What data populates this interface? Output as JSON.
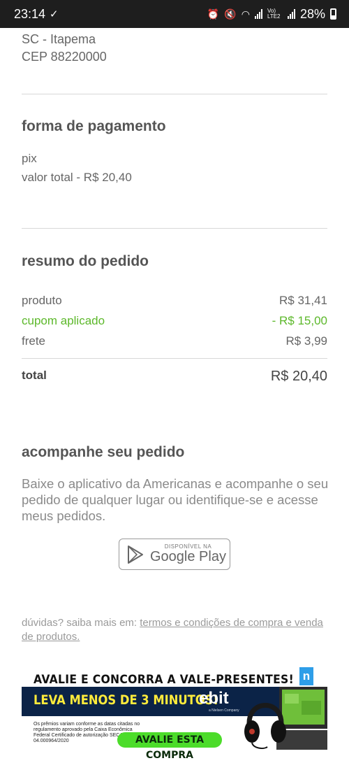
{
  "status_bar": {
    "time": "23:14",
    "network_label": "Vo) LTE2",
    "battery": "28%"
  },
  "address": {
    "line1": "SC - Itapema",
    "line2": "CEP 88220000"
  },
  "payment": {
    "title": "forma de pagamento",
    "method": "pix",
    "total_line": "valor total - R$ 20,40"
  },
  "summary": {
    "title": "resumo do pedido",
    "rows": [
      {
        "label": "produto",
        "value": "R$ 31,41"
      },
      {
        "label": "cupom aplicado",
        "value": "- R$ 15,00"
      },
      {
        "label": "frete",
        "value": "R$ 3,99"
      }
    ],
    "total_label": "total",
    "total_value": "R$ 20,40",
    "coupon_color": "#5cb82a"
  },
  "follow": {
    "title": "acompanhe seu pedido",
    "text": "Baixe o aplicativo da Americanas e acompanhe o seu pedido de qualquer lugar ou identifique-se e acesse meus pedidos.",
    "store_small": "DISPONÍVEL NA",
    "store_big": "Google Play"
  },
  "help": {
    "prefix": "dúvidas? saiba mais em: ",
    "link": "termos e condições de compra e venda de produtos."
  },
  "banner": {
    "headline": "AVALIE E CONCORRA A VALE-PRESENTES!",
    "badge": "n",
    "lead": "LEVA MENOS DE 3 MINUTOS!",
    "brand": "ebit",
    "brand_sub": "a Nielsen Company",
    "fine_print": "Os prêmios variam conforme as datas citadas no regulamento aprovado pela Caixa Econômica Federal Certificado de autorização SECAP nº. 04.000964/2020",
    "cta": "AVALIE ESTA COMPRA"
  }
}
